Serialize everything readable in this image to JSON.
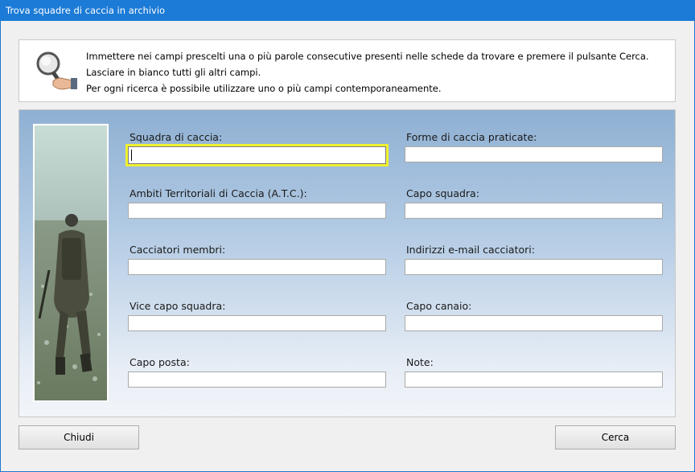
{
  "window": {
    "title": "Trova squadre di caccia in archivio"
  },
  "info": {
    "icon": "magnifier-hand-icon",
    "lines": [
      "Immettere nei campi prescelti una o più parole consecutive presenti nelle schede da trovare e premere il pulsante Cerca.",
      "Lasciare in bianco tutti gli altri campi.",
      "Per ogni ricerca è possibile utilizzare uno o più campi contemporaneamente."
    ]
  },
  "form": {
    "fields": [
      {
        "label": "Squadra di caccia:",
        "value": ""
      },
      {
        "label": "Forme di caccia praticate:",
        "value": ""
      },
      {
        "label": "Ambiti Territoriali di Caccia (A.T.C.):",
        "value": ""
      },
      {
        "label": "Capo squadra:",
        "value": ""
      },
      {
        "label": "Cacciatori membri:",
        "value": ""
      },
      {
        "label": "Indirizzi e-mail cacciatori:",
        "value": ""
      },
      {
        "label": "Vice capo squadra:",
        "value": ""
      },
      {
        "label": "Capo canaio:",
        "value": ""
      },
      {
        "label": "Capo posta:",
        "value": ""
      },
      {
        "label": "Note:",
        "value": ""
      }
    ],
    "focus_color": "#f0f030"
  },
  "buttons": {
    "close": "Chiudi",
    "search": "Cerca"
  },
  "colors": {
    "titlebar": "#1c7bd6",
    "panel_gradient_top": "#8fb0d3",
    "panel_gradient_bottom": "#f2f5f9"
  }
}
